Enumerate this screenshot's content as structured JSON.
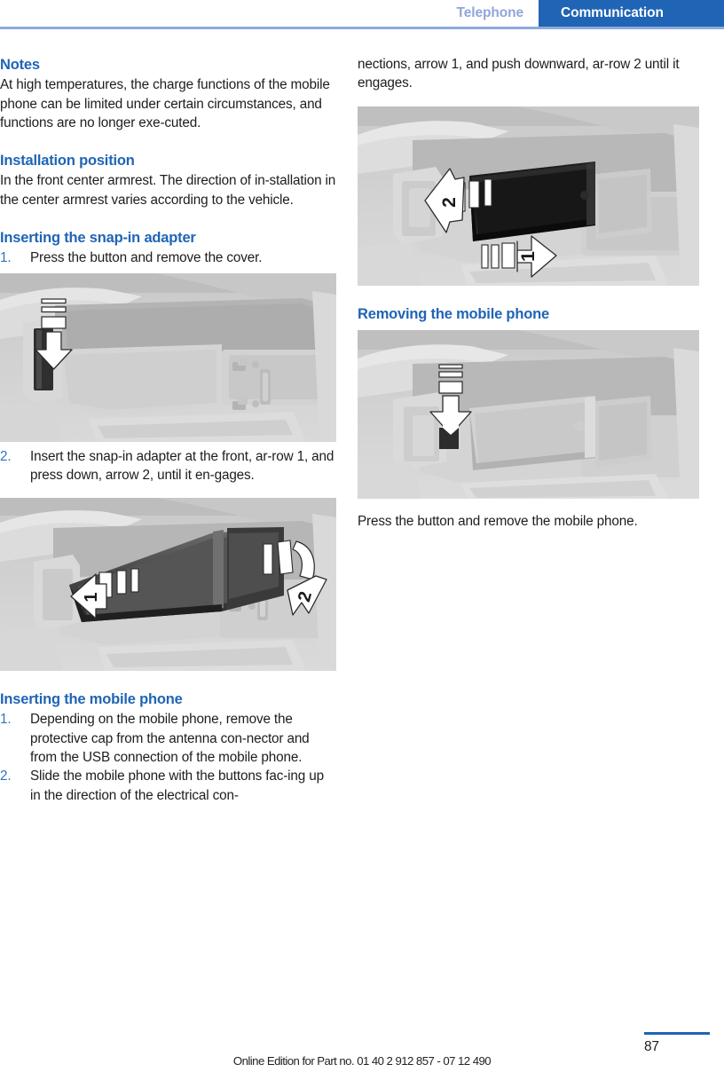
{
  "header": {
    "section_tab": "Telephone",
    "chapter_tab": "Communication",
    "accent_blue": "#1f64b5",
    "muted_blue": "#8fa6d9",
    "rule_blue": "#8da9dc"
  },
  "left_column": {
    "notes_heading": "Notes",
    "notes_body": "At high temperatures, the charge functions of the mobile phone can be limited under certain circumstances, and functions are no longer exe-cuted.",
    "install_heading": "Installation position",
    "install_body": "In the front center armrest. The direction of in-stallation in the center armrest varies according to the vehicle.",
    "adapter_heading": "Inserting the snap-in adapter",
    "adapter_step_1_num": "1.",
    "adapter_step_1": "Press the button and remove the cover.",
    "adapter_step_2_num": "2.",
    "adapter_step_2": "Insert the snap-in adapter at the front, ar-row 1, and press down, arrow 2, until it en-gages.",
    "phone_heading": "Inserting the mobile phone",
    "phone_step_1_num": "1.",
    "phone_step_1": "Depending on the mobile phone, remove the protective cap from the antenna con-nector and from the USB connection of the mobile phone.",
    "phone_step_2_num": "2.",
    "phone_step_2": "Slide the mobile phone with the buttons fac-ing up in the direction of the electrical con-",
    "figure_1_caption": "center-armrest-cover-press-button-down-arrow",
    "figure_2_caption": "snap-in-adapter-insert-arrow-1-arrow-2"
  },
  "right_column": {
    "continued_body": "nections, arrow 1, and push downward, ar-row 2 until it engages.",
    "removing_heading": "Removing the mobile phone",
    "removing_body": "Press the button and remove the mobile phone.",
    "figure_3_caption": "mobile-phone-insert-arrow-1-arrow-2",
    "figure_4_caption": "mobile-phone-release-button-down-arrow"
  },
  "figures": {
    "arrow_label_1": "1",
    "arrow_label_2": "2"
  },
  "footer": {
    "edition_note": "Online Edition for Part no. 01 40 2 912 857 - 07 12 490",
    "page_number": "87"
  }
}
